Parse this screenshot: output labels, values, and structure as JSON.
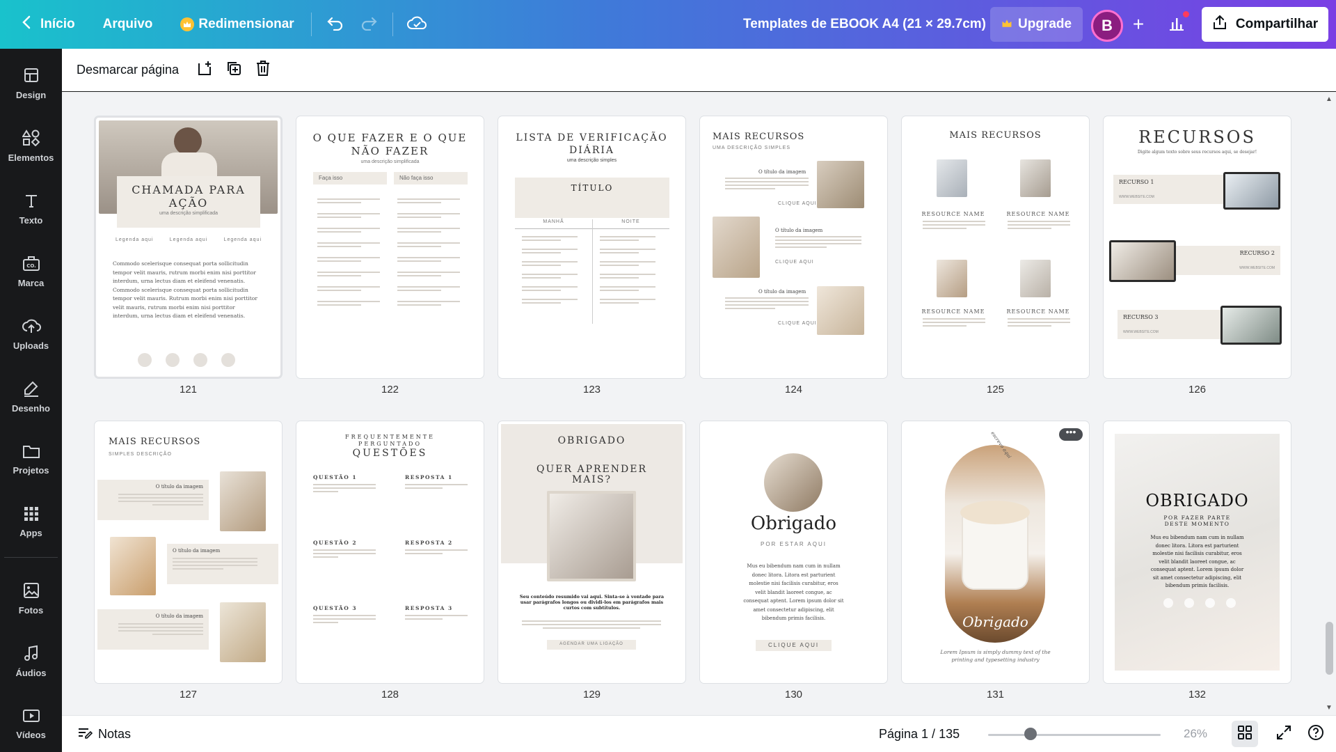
{
  "topbar": {
    "back_label": "Início",
    "file_label": "Arquivo",
    "resize_label": "Redimensionar",
    "doc_title": "Templates de EBOOK A4 (21 × 29.7cm)",
    "upgrade_label": "Upgrade",
    "avatar_initial": "B",
    "share_label": "Compartilhar"
  },
  "sidebar": {
    "items": [
      {
        "label": "Design",
        "icon": "layout-icon"
      },
      {
        "label": "Elementos",
        "icon": "shapes-icon"
      },
      {
        "label": "Texto",
        "icon": "text-icon"
      },
      {
        "label": "Marca",
        "icon": "brand-icon"
      },
      {
        "label": "Uploads",
        "icon": "cloud-upload-icon"
      },
      {
        "label": "Desenho",
        "icon": "pen-icon"
      },
      {
        "label": "Projetos",
        "icon": "folder-icon"
      },
      {
        "label": "Apps",
        "icon": "apps-grid-icon"
      },
      {
        "label": "Fotos",
        "icon": "image-icon"
      },
      {
        "label": "Áudios",
        "icon": "music-note-icon"
      },
      {
        "label": "Vídeos",
        "icon": "video-icon"
      }
    ]
  },
  "subbar": {
    "deselect_label": "Desmarcar página"
  },
  "pages": [
    {
      "number": "121",
      "heading": "CHAMADA PARA AÇÃO",
      "sub": "uma descrição simplificada",
      "legend": "Legenda aqui",
      "body": "Commodo scelerisque consequat porta sollicitudin tempor velit mauris, rutrum morbi enim nisi porttitor interdum, urna lectus diam et eleifend venenatis. Commodo scelerisque consequat porta sollicitudin tempor velit mauris. Rutrum morbi enim nisi porttitor velit mauris, rutrum morbi enim nisi porttitor interdum, urna lectus diam et eleifend venenatis."
    },
    {
      "number": "122",
      "heading": "O QUE FAZER E O QUE NÃO FAZER",
      "sub": "uma descrição simplificada",
      "col1": "Faça isso",
      "col2": "Não faça isso"
    },
    {
      "number": "123",
      "heading": "LISTA DE VERIFICAÇÃO DIÁRIA",
      "sub": "uma descrição simples",
      "box": "TÍTULO",
      "col1": "MANHÃ",
      "col2": "NOITE"
    },
    {
      "number": "124",
      "heading": "MAIS RECURSOS",
      "sub": "UMA DESCRIÇÃO SIMPLES",
      "item_title": "O título da imagem",
      "link": "CLIQUE AQUI"
    },
    {
      "number": "125",
      "heading": "MAIS RECURSOS",
      "item_title": "RESOURCE NAME"
    },
    {
      "number": "126",
      "heading": "RECURSOS",
      "sub": "Digite algum texto sobre seus recursos aqui, se desejar!",
      "r1": "RECURSO 1",
      "r2": "RECURSO 2",
      "r3": "RECURSO 3",
      "site": "WWW.WEBSITE.COM"
    },
    {
      "number": "127",
      "heading": "MAIS RECURSOS",
      "sub": "SIMPLES DESCRIÇÃO",
      "item_title": "O título da imagem"
    },
    {
      "number": "128",
      "kicker": "FREQUENTEMENTE PERGUNTADO",
      "heading": "QUESTÕES",
      "q": [
        "QUESTÃO 1",
        "QUESTÃO 2",
        "QUESTÃO 3"
      ],
      "a": [
        "RESPOSTA 1",
        "RESPOSTA 2",
        "RESPOSTA 3"
      ]
    },
    {
      "number": "129",
      "heading": "OBRIGADO",
      "sub": "QUER APRENDER MAIS?",
      "body": "Seu conteúdo resumido vai aqui. Sinta-se à vontade para usar parágrafos longos ou dividi-los em parágrafos mais curtos com subtítulos.",
      "cta": "AGENDAR UMA LIGAÇÃO"
    },
    {
      "number": "130",
      "heading": "Obrigado",
      "sub": "POR ESTAR AQUI",
      "body": "Mus eu bibendum nam cum in nullam donec litora. Litora est parturient molestie nisi facilisis curabitur, eros velit blandit laoreet congue, ac consequat aptent. Lorem ipsum dolor sit amet consectetur adipiscing, elit bibendum primis facilisis.",
      "cta": "CLIQUE AQUI"
    },
    {
      "number": "131",
      "heading": "Obrigado",
      "arc": "escrevo aqui",
      "body": "Lorem Ipsum is simply dummy text of the printing and typesetting industry"
    },
    {
      "number": "132",
      "heading": "OBRIGADO",
      "sub": "POR FAZER PARTE DESTE MOMENTO",
      "body": "Mus eu bibendum nam cum in nullam donec litora. Litora est parturient molestie nisi facilisis curabitur, eros velit blandit laoreet congue, ac consequat aptent. Lorem ipsum dolor sit amet consectetur adipiscing, elit bibendum primis facilisis."
    }
  ],
  "bottombar": {
    "notes_label": "Notas",
    "page_indicator": "Página 1 / 135",
    "zoom_label": "26%",
    "zoom_level": 0.26
  },
  "colors": {
    "brand_gradient_start": "#19c2cc",
    "brand_gradient_end": "#7a3fe4",
    "sidebar_bg": "#18191b",
    "page_beige": "#efebe5"
  }
}
